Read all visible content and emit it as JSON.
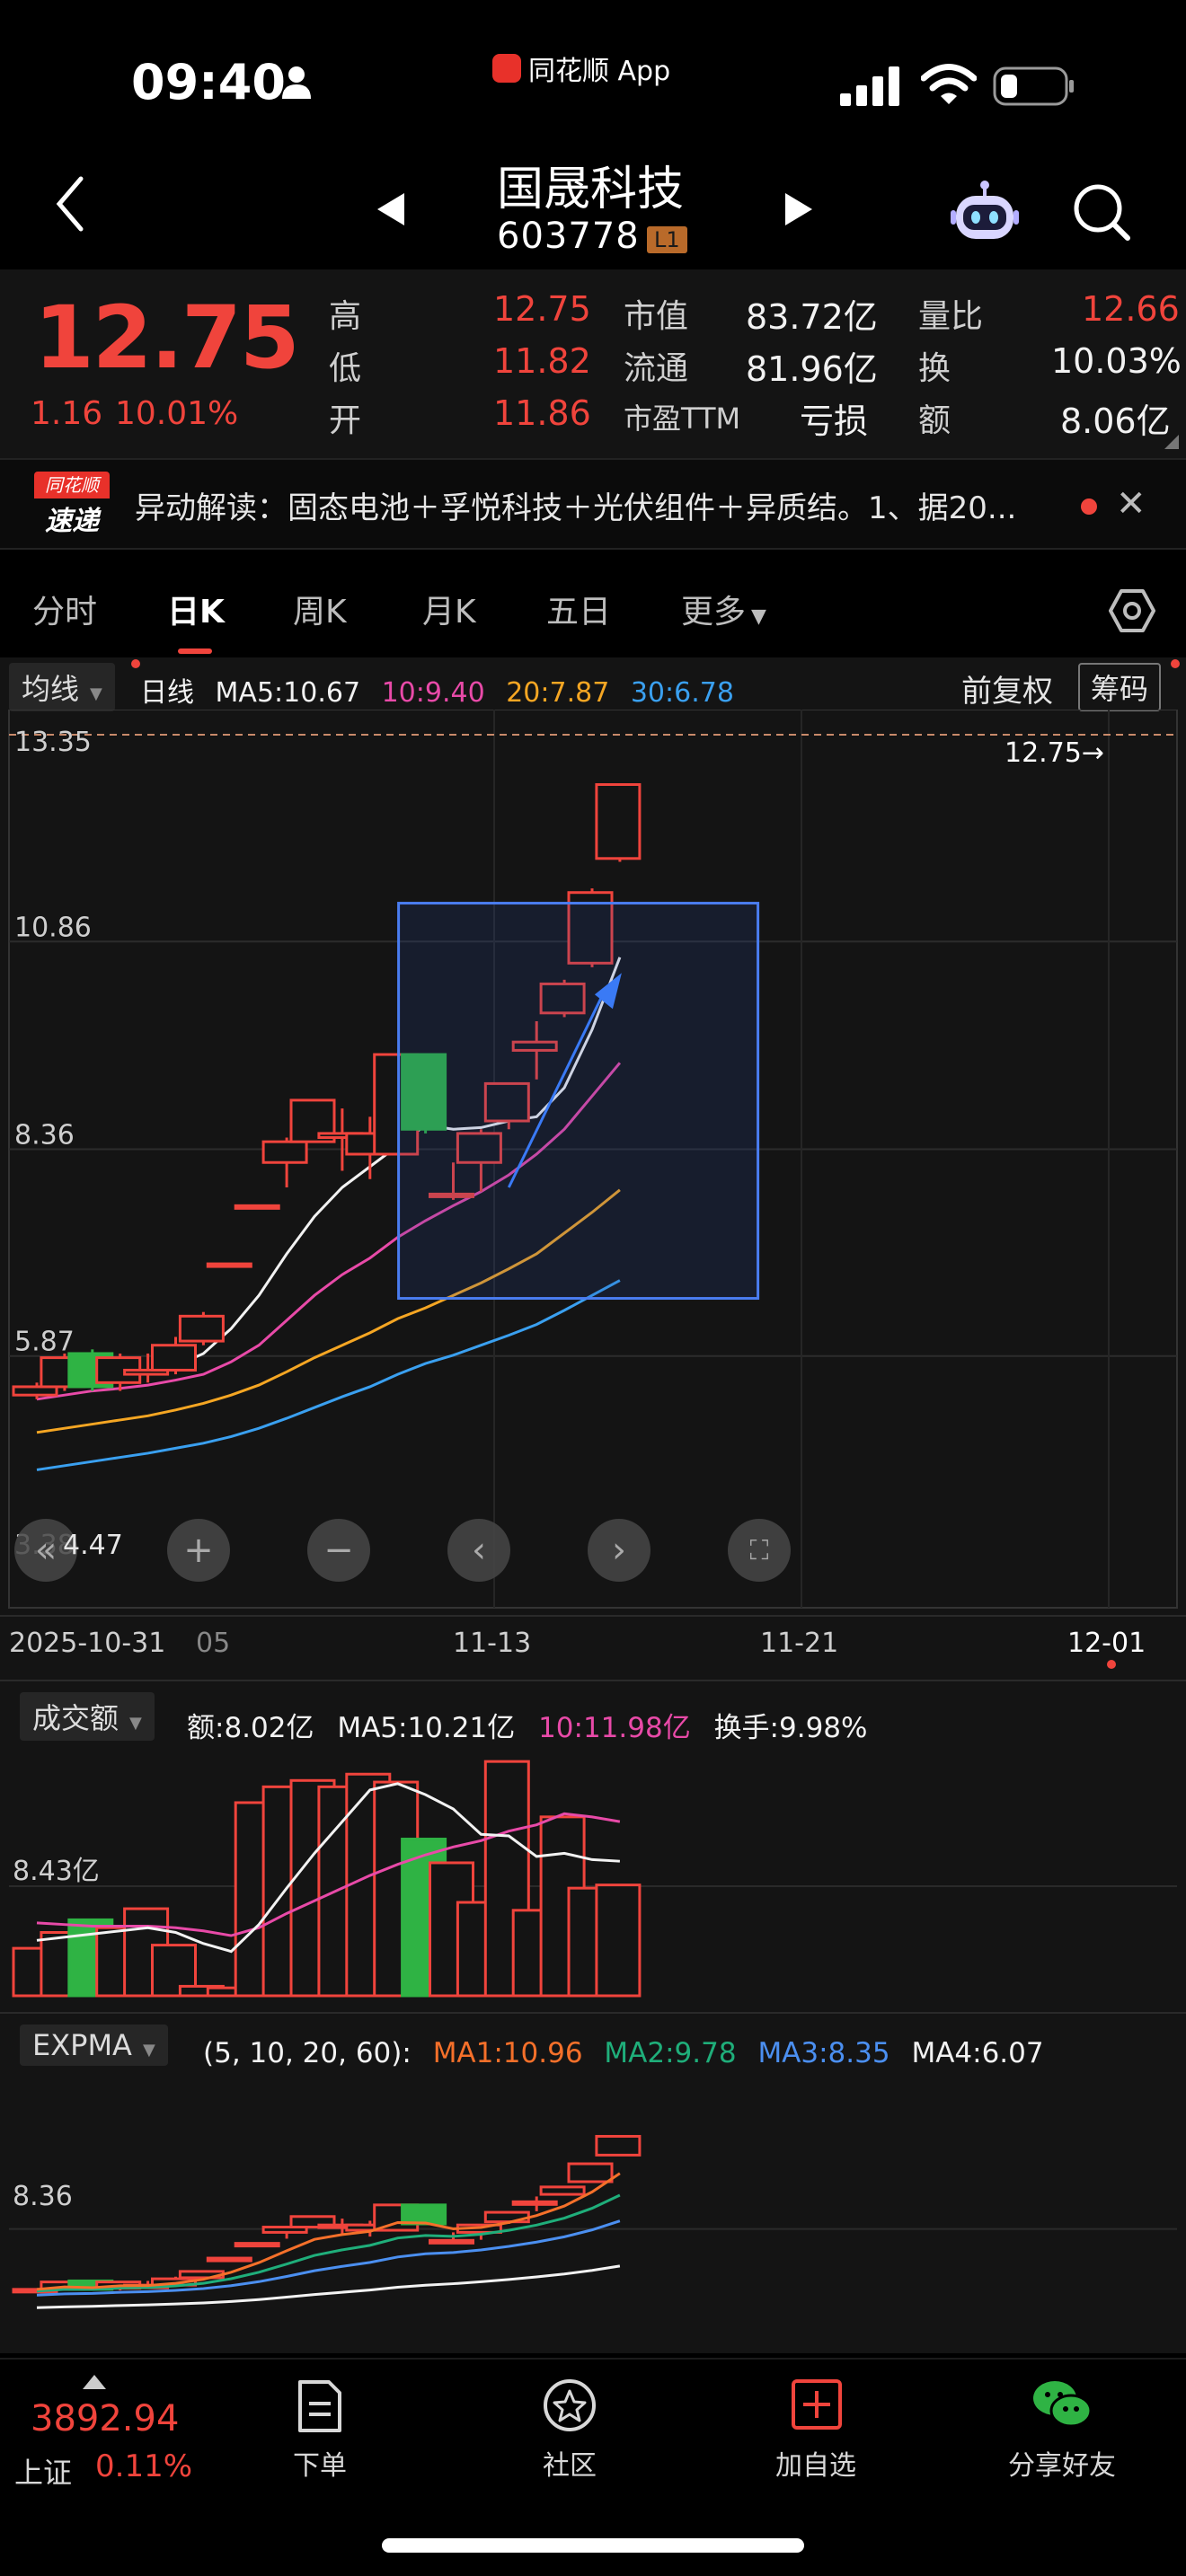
{
  "status_bar": {
    "time": "09:40",
    "back_app": "同花顺 App",
    "icons": [
      "person-icon",
      "signal-icon",
      "wifi-icon",
      "battery-icon"
    ]
  },
  "header": {
    "name": "国晟科技",
    "code": "603778",
    "level": "L1",
    "icons": [
      "back-icon",
      "prev-icon",
      "next-icon",
      "robot-icon",
      "search-icon"
    ]
  },
  "quote": {
    "price": "12.75",
    "change": "1.16",
    "change_pct": "10.01%",
    "fields": {
      "high_label": "高",
      "high": "12.75",
      "low_label": "低",
      "low": "11.82",
      "open_label": "开",
      "open": "11.86",
      "mktcap_label": "市值",
      "mktcap": "83.72亿",
      "float_label": "流通",
      "float": "81.96亿",
      "pe_label": "市盈TTM",
      "pe": "亏损",
      "volratio_label": "量比",
      "volratio": "12.66",
      "turnover_label": "换",
      "turnover": "10.03%",
      "amount_label": "额",
      "amount": "8.06亿"
    }
  },
  "news": {
    "logo_top": "同花顺",
    "logo_bottom": "速递",
    "text": "异动解读：固态电池＋孚悦科技＋光伏组件＋异质结。1、据20..."
  },
  "tabs": [
    "分时",
    "日K",
    "周K",
    "月K",
    "五日",
    "更多"
  ],
  "active_tab": "日K",
  "kline": {
    "indicator": "均线",
    "period": "日线",
    "ma5": "MA5:10.67",
    "ma10": "10:9.40",
    "ma20": "20:7.87",
    "ma30": "30:6.78",
    "adjust": "前复权",
    "chips": "筹码",
    "y_labels": [
      "13.35",
      "10.86",
      "8.36",
      "5.87",
      "3.38"
    ],
    "left_label": "4.47",
    "last_price_tag": "12.75→",
    "dates": [
      "2025-10-31",
      "05",
      "11-13",
      "11-21",
      "12-01"
    ]
  },
  "volume": {
    "indicator": "成交额",
    "amount": "额:8.02亿",
    "ma5": "MA5:10.21亿",
    "ma10": "10:11.98亿",
    "turnover": "换手:9.98%",
    "y_label": "8.43亿"
  },
  "expma": {
    "indicator": "EXPMA",
    "params": "(5, 10, 20, 60):",
    "ma1": "MA1:10.96",
    "ma2": "MA2:9.78",
    "ma3": "MA3:8.35",
    "ma4": "MA4:6.07",
    "y_label": "8.36"
  },
  "chart_data": {
    "type": "candlestick",
    "ylim": [
      3.38,
      13.35
    ],
    "candles": [
      {
        "o": 5.4,
        "c": 5.5,
        "h": 5.55,
        "l": 5.35,
        "up": true
      },
      {
        "o": 5.5,
        "c": 5.85,
        "h": 5.9,
        "l": 5.45,
        "up": true
      },
      {
        "o": 5.9,
        "c": 5.5,
        "h": 5.95,
        "l": 5.45,
        "up": false
      },
      {
        "o": 5.55,
        "c": 5.85,
        "h": 5.9,
        "l": 5.45,
        "up": true
      },
      {
        "o": 5.65,
        "c": 5.7,
        "h": 5.9,
        "l": 5.55,
        "up": true
      },
      {
        "o": 5.7,
        "c": 6.0,
        "h": 6.1,
        "l": 5.65,
        "up": true
      },
      {
        "o": 6.05,
        "c": 6.35,
        "h": 6.4,
        "l": 6.0,
        "up": true
      },
      {
        "o": 6.98,
        "c": 6.98,
        "h": 6.98,
        "l": 6.98,
        "up": true
      },
      {
        "o": 7.68,
        "c": 7.68,
        "h": 7.68,
        "l": 7.68,
        "up": true
      },
      {
        "o": 8.2,
        "c": 8.45,
        "h": 8.5,
        "l": 7.9,
        "up": true
      },
      {
        "o": 8.45,
        "c": 8.95,
        "h": 8.95,
        "l": 8.45,
        "up": true
      },
      {
        "o": 8.5,
        "c": 8.55,
        "h": 8.85,
        "l": 8.1,
        "up": true
      },
      {
        "o": 8.3,
        "c": 8.55,
        "h": 8.75,
        "l": 8.0,
        "up": true
      },
      {
        "o": 8.3,
        "c": 9.5,
        "h": 9.5,
        "l": 8.3,
        "up": true
      },
      {
        "o": 9.5,
        "c": 8.6,
        "h": 9.5,
        "l": 8.55,
        "up": false
      },
      {
        "o": 7.82,
        "c": 7.82,
        "h": 8.2,
        "l": 7.75,
        "up": true
      },
      {
        "o": 8.2,
        "c": 8.55,
        "h": 8.6,
        "l": 7.85,
        "up": true
      },
      {
        "o": 8.7,
        "c": 9.15,
        "h": 9.15,
        "l": 8.6,
        "up": true
      },
      {
        "o": 9.55,
        "c": 9.65,
        "h": 9.9,
        "l": 9.2,
        "up": true
      },
      {
        "o": 10.0,
        "c": 10.35,
        "h": 10.4,
        "l": 9.95,
        "up": true
      },
      {
        "o": 10.6,
        "c": 11.45,
        "h": 11.5,
        "l": 10.55,
        "up": true
      },
      {
        "o": 11.86,
        "c": 12.75,
        "h": 12.75,
        "l": 11.82,
        "up": true
      }
    ],
    "ma_white": [
      5.45,
      5.52,
      5.58,
      5.62,
      5.68,
      5.75,
      5.9,
      6.2,
      6.6,
      7.1,
      7.55,
      7.9,
      8.15,
      8.4,
      8.65,
      8.6,
      8.62,
      8.7,
      8.75,
      9.1,
      9.8,
      10.67
    ],
    "ma_pink": [
      5.35,
      5.4,
      5.45,
      5.48,
      5.52,
      5.58,
      5.65,
      5.8,
      6.0,
      6.3,
      6.6,
      6.85,
      7.05,
      7.3,
      7.5,
      7.68,
      7.85,
      8.05,
      8.3,
      8.6,
      9.0,
      9.4
    ],
    "ma_orange": [
      4.95,
      5.0,
      5.05,
      5.1,
      5.15,
      5.22,
      5.3,
      5.4,
      5.52,
      5.68,
      5.85,
      6.0,
      6.15,
      6.32,
      6.45,
      6.6,
      6.75,
      6.92,
      7.1,
      7.35,
      7.6,
      7.87
    ],
    "ma_blue": [
      4.5,
      4.55,
      4.6,
      4.65,
      4.7,
      4.76,
      4.82,
      4.9,
      5.0,
      5.12,
      5.25,
      5.38,
      5.5,
      5.65,
      5.78,
      5.88,
      6.0,
      6.12,
      6.25,
      6.42,
      6.6,
      6.78
    ],
    "volume": [
      3.0,
      4.0,
      4.8,
      4.3,
      5.5,
      3.2,
      0.6,
      0.5,
      12.2,
      13.2,
      13.6,
      13.2,
      14.0,
      13.5,
      9.9,
      8.4,
      5.9,
      14.8,
      5.4,
      11.3,
      6.8,
      7.0
    ],
    "volume_ymax": 16,
    "vol_ma_white": [
      3.5,
      3.7,
      3.9,
      4.1,
      4.3,
      4.0,
      3.3,
      2.8,
      4.5,
      6.8,
      9.0,
      11.0,
      13.0,
      13.4,
      12.7,
      11.8,
      10.2,
      10.1,
      8.8,
      9.0,
      8.6,
      8.5
    ],
    "vol_ma_pink": [
      4.6,
      4.5,
      4.4,
      4.4,
      4.4,
      4.3,
      4.1,
      3.8,
      4.3,
      5.2,
      6.0,
      6.8,
      7.6,
      8.3,
      8.9,
      9.4,
      9.8,
      10.4,
      10.8,
      11.5,
      11.3,
      11.0
    ]
  },
  "bottom_bar": {
    "index_value": "3892.94",
    "index_name": "上证",
    "index_pct": "0.11%",
    "items": [
      {
        "label": "下单",
        "icon": "order-icon"
      },
      {
        "label": "社区",
        "icon": "community-icon"
      },
      {
        "label": "加自选",
        "icon": "add-watchlist-icon"
      },
      {
        "label": "分享好友",
        "icon": "wechat-icon"
      }
    ]
  }
}
